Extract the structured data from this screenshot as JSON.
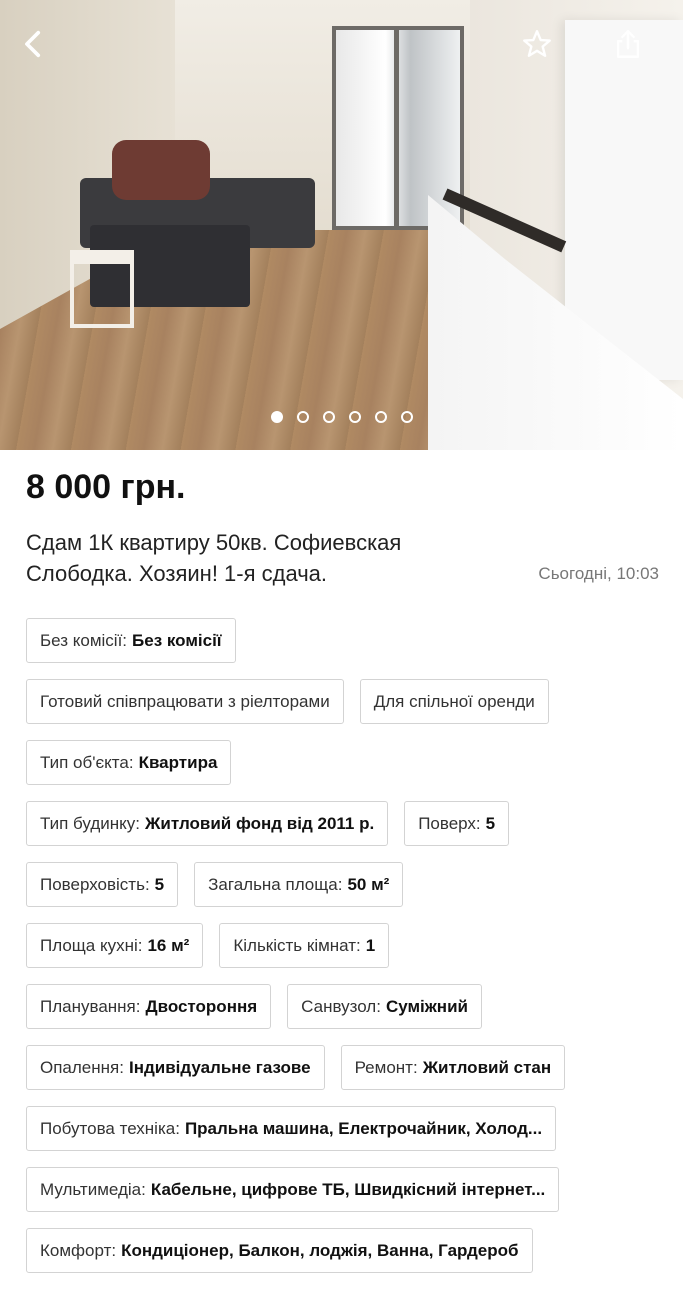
{
  "header": {
    "back_icon": "chevron-left-icon",
    "favorite_icon": "star-outline-icon",
    "share_icon": "share-icon"
  },
  "gallery": {
    "slide_count": 6,
    "active_index": 0
  },
  "listing": {
    "price": "8 000 грн.",
    "title": "Сдам 1К квартиру 50кв. Софиевская Слободка. Хозяин! 1-я сдача.",
    "date": "Сьогодні, 10:03"
  },
  "params": [
    [
      {
        "label": "Без комісії:",
        "value": "Без комісії"
      }
    ],
    [
      {
        "label": "Готовий співпрацювати з ріелторами",
        "value": ""
      },
      {
        "label": "Для спільної оренди",
        "value": ""
      }
    ],
    [
      {
        "label": "Тип об'єкта:",
        "value": "Квартира"
      }
    ],
    [
      {
        "label": "Тип будинку:",
        "value": "Житловий фонд від 2011 р."
      },
      {
        "label": "Поверх:",
        "value": "5"
      }
    ],
    [
      {
        "label": "Поверховість:",
        "value": "5"
      },
      {
        "label": "Загальна площа:",
        "value": "50 м²"
      }
    ],
    [
      {
        "label": "Площа кухні:",
        "value": "16 м²"
      },
      {
        "label": "Кількість кімнат:",
        "value": "1"
      }
    ],
    [
      {
        "label": "Планування:",
        "value": "Двостороння"
      },
      {
        "label": "Санвузол:",
        "value": "Суміжний"
      }
    ],
    [
      {
        "label": "Опалення:",
        "value": "Індивідуальне газове"
      },
      {
        "label": "Ремонт:",
        "value": "Житловий стан"
      }
    ],
    [
      {
        "label": "Побутова техніка:",
        "value": "Пральна машина, Електрочайник, Холод..."
      }
    ],
    [
      {
        "label": "Мультимедіа:",
        "value": "Кабельне, цифрове ТБ, Швидкісний інтернет..."
      }
    ],
    [
      {
        "label": "Комфорт:",
        "value": "Кондиціонер, Балкон, лоджія, Ванна, Гардероб"
      }
    ]
  ]
}
